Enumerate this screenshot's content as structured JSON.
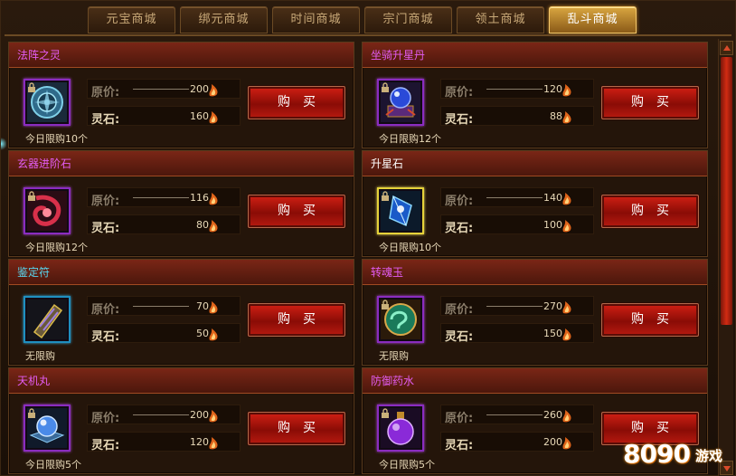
{
  "tabs": [
    {
      "label": "元宝商城",
      "active": false
    },
    {
      "label": "绑元商城",
      "active": false
    },
    {
      "label": "时间商城",
      "active": false
    },
    {
      "label": "宗门商城",
      "active": false
    },
    {
      "label": "领土商城",
      "active": false
    },
    {
      "label": "乱斗商城",
      "active": true
    }
  ],
  "labels": {
    "original_price": "原价:",
    "spirit_stone": "灵石:",
    "buy": "购买"
  },
  "items": [
    {
      "name": "法阵之灵",
      "name_color": "purple",
      "icon": "formation-disc-icon",
      "original": "200",
      "price": "160",
      "limit": "今日限购10个"
    },
    {
      "name": "坐骑升星丹",
      "name_color": "purple",
      "icon": "mount-star-pill-icon",
      "original": "120",
      "price": "88",
      "limit": "今日限购12个"
    },
    {
      "name": "玄器进阶石",
      "name_color": "purple",
      "icon": "artifact-advance-stone-icon",
      "original": "116",
      "price": "80",
      "limit": "今日限购12个"
    },
    {
      "name": "升星石",
      "name_color": "white",
      "icon": "star-rise-stone-icon",
      "original": "140",
      "price": "100",
      "limit": "今日限购10个"
    },
    {
      "name": "鉴定符",
      "name_color": "cyan",
      "icon": "appraisal-talisman-icon",
      "original": "70",
      "price": "50",
      "limit": "无限购"
    },
    {
      "name": "转魂玉",
      "name_color": "purple",
      "icon": "soul-jade-icon",
      "original": "270",
      "price": "150",
      "limit": "无限购"
    },
    {
      "name": "天机丸",
      "name_color": "purple",
      "icon": "heaven-pill-icon",
      "original": "200",
      "price": "120",
      "limit": "今日限购5个"
    },
    {
      "name": "防御药水",
      "name_color": "purple",
      "icon": "defense-potion-icon",
      "original": "260",
      "price": "200",
      "limit": "今日限购5个"
    }
  ],
  "watermark": {
    "number": "8090",
    "text": "游戏"
  }
}
